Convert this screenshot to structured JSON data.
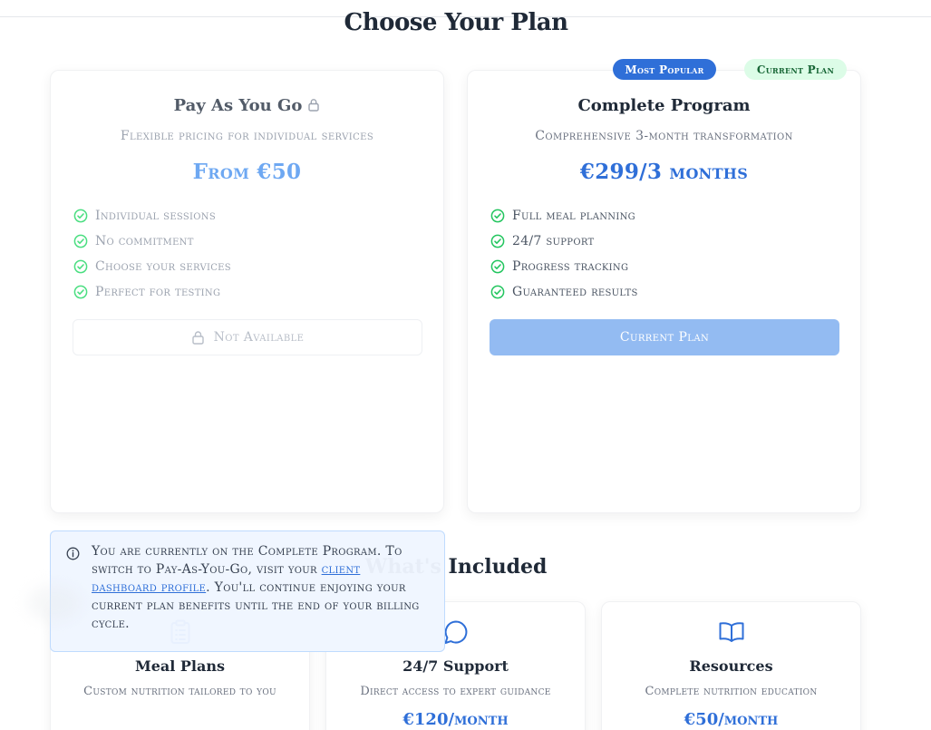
{
  "page": {
    "title": "Choose Your Plan"
  },
  "plans": [
    {
      "name": "Pay As You Go",
      "description": "Flexible pricing for individual services",
      "price": "From €50",
      "features": [
        "Individual sessions",
        "No commitment",
        "Choose your services",
        "Perfect for testing"
      ],
      "button_label": "Not Available",
      "locked": true
    },
    {
      "name": "Complete Program",
      "description": "Comprehensive 3-month transformation",
      "price": "€299/3 months",
      "features": [
        "Full meal planning",
        "24/7 support",
        "Progress tracking",
        "Guaranteed results"
      ],
      "button_label": "Current Plan",
      "badges": {
        "popular": "Most Popular",
        "current": "Current Plan"
      }
    }
  ],
  "included": {
    "heading": "What's Included",
    "items": [
      {
        "title": "Meal Plans",
        "description": "Custom nutrition tailored to you",
        "price": "",
        "icon": "clipboard-icon"
      },
      {
        "title": "24/7 Support",
        "description": "Direct access to expert guidance",
        "price": "€120/month",
        "icon": "chat-bubble-icon"
      },
      {
        "title": "Resources",
        "description": "Complete nutrition education",
        "price": "€50/month",
        "icon": "book-icon"
      }
    ]
  },
  "notice": {
    "text_before": "You are currently on the Complete Program. To switch to Pay-As-You-Go, visit your ",
    "link_text": "client dashboard profile",
    "text_after": ". You'll continue enjoying your current plan benefits until the end of your billing cycle."
  },
  "colors": {
    "accent": "#2f6fd8",
    "badge_popular_bg": "#2f6fd8",
    "badge_current_bg": "#dcfce7",
    "badge_current_text": "#166534",
    "check_green": "#22c55e",
    "notice_bg": "#eff6ff"
  }
}
